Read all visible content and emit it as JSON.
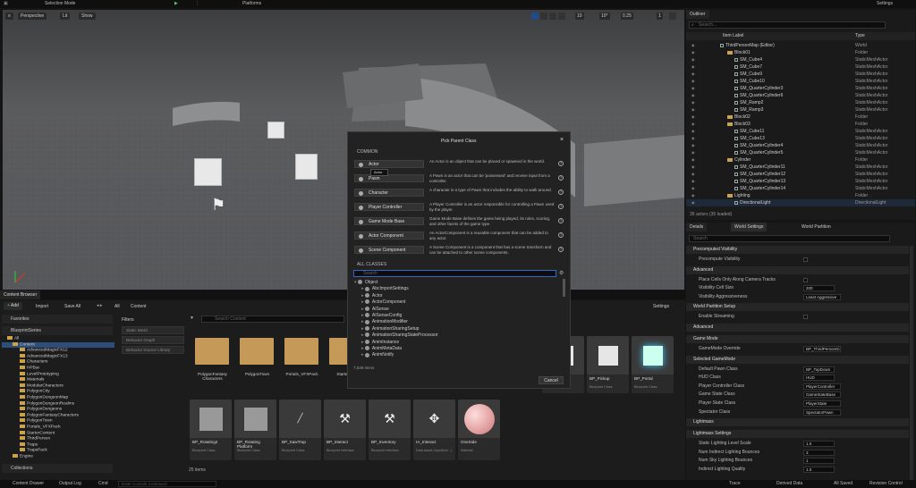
{
  "topbar": {
    "mode": "Selection Mode",
    "platforms": "Platforms",
    "settings": "Settings"
  },
  "viewport": {
    "perspective": "Perspective",
    "lit": "Lit",
    "show": "Show",
    "snap_angle": "10°",
    "snap_scale": "0.25",
    "cam_speed": "1",
    "grid": "10"
  },
  "outliner": {
    "tab": "Outliner",
    "col_label": "Item Label",
    "col_type": "Type",
    "search_placeholder": "Search...",
    "rows": [
      {
        "label": "ThirdPersonMap (Editor)",
        "type": "World",
        "indent": 0,
        "kind": "world"
      },
      {
        "label": "Block01",
        "type": "Folder",
        "indent": 1,
        "kind": "folder"
      },
      {
        "label": "SM_Cube4",
        "type": "StaticMeshActor",
        "indent": 2,
        "kind": "entity"
      },
      {
        "label": "SM_Cube7",
        "type": "StaticMeshActor",
        "indent": 2,
        "kind": "entity"
      },
      {
        "label": "SM_Cube9",
        "type": "StaticMeshActor",
        "indent": 2,
        "kind": "entity"
      },
      {
        "label": "SM_Cube10",
        "type": "StaticMeshActor",
        "indent": 2,
        "kind": "entity"
      },
      {
        "label": "SM_QuarterCylinder3",
        "type": "StaticMeshActor",
        "indent": 2,
        "kind": "entity"
      },
      {
        "label": "SM_QuarterCylinder6",
        "type": "StaticMeshActor",
        "indent": 2,
        "kind": "entity"
      },
      {
        "label": "SM_Ramp2",
        "type": "StaticMeshActor",
        "indent": 2,
        "kind": "entity"
      },
      {
        "label": "SM_Ramp3",
        "type": "StaticMeshActor",
        "indent": 2,
        "kind": "entity"
      },
      {
        "label": "Block02",
        "type": "Folder",
        "indent": 1,
        "kind": "folder"
      },
      {
        "label": "Block03",
        "type": "Folder",
        "indent": 1,
        "kind": "folder"
      },
      {
        "label": "SM_Cube11",
        "type": "StaticMeshActor",
        "indent": 2,
        "kind": "entity"
      },
      {
        "label": "SM_Cube13",
        "type": "StaticMeshActor",
        "indent": 2,
        "kind": "entity"
      },
      {
        "label": "SM_QuarterCylinder4",
        "type": "StaticMeshActor",
        "indent": 2,
        "kind": "entity"
      },
      {
        "label": "SM_QuarterCylinder5",
        "type": "StaticMeshActor",
        "indent": 2,
        "kind": "entity"
      },
      {
        "label": "Cylinder",
        "type": "Folder",
        "indent": 1,
        "kind": "folder"
      },
      {
        "label": "SM_QuarterCylinder11",
        "type": "StaticMeshActor",
        "indent": 2,
        "kind": "entity"
      },
      {
        "label": "SM_QuarterCylinder12",
        "type": "StaticMeshActor",
        "indent": 2,
        "kind": "entity"
      },
      {
        "label": "SM_QuarterCylinder13",
        "type": "StaticMeshActor",
        "indent": 2,
        "kind": "entity"
      },
      {
        "label": "SM_QuarterCylinder14",
        "type": "StaticMeshActor",
        "indent": 2,
        "kind": "entity"
      },
      {
        "label": "Lighting",
        "type": "Folder",
        "indent": 1,
        "kind": "folder"
      },
      {
        "label": "DirectionalLight",
        "type": "DirectionalLight",
        "indent": 2,
        "kind": "entity"
      }
    ],
    "status": "35 actors (35 loaded)"
  },
  "details": {
    "tabs": [
      "Details",
      "World Settings",
      "World Partition"
    ],
    "search_placeholder": "Search",
    "sections": [
      {
        "title": "Precomputed Visibility",
        "props": [
          {
            "label": "Precompute Visibility",
            "kind": "check"
          }
        ]
      },
      {
        "title": "Advanced",
        "props": [
          {
            "label": "Place Cells Only Along Camera Tracks",
            "kind": "check"
          },
          {
            "label": "Visibility Cell Size",
            "kind": "value",
            "value": "200"
          },
          {
            "label": "Visibility Aggressiveness",
            "kind": "value",
            "value": "Least Aggressive"
          }
        ]
      },
      {
        "title": "World Partition Setup",
        "props": [
          {
            "label": "Enable Streaming",
            "kind": "check"
          }
        ]
      },
      {
        "title": "Advanced",
        "props": []
      },
      {
        "title": "Game Mode",
        "props": [
          {
            "label": "GameMode Override",
            "kind": "value",
            "value": "BP_ThirdPersonGi"
          }
        ]
      },
      {
        "title": "Selected GameMode",
        "props": [
          {
            "label": "Default Pawn Class",
            "kind": "value",
            "value": "BP_TopDown"
          },
          {
            "label": "HUD Class",
            "kind": "value",
            "value": "HUD"
          },
          {
            "label": "Player Controller Class",
            "kind": "value",
            "value": "PlayerController"
          },
          {
            "label": "Game State Class",
            "kind": "value",
            "value": "GameStateBase"
          },
          {
            "label": "Player State Class",
            "kind": "value",
            "value": "PlayerState"
          },
          {
            "label": "Spectator Class",
            "kind": "value",
            "value": "SpectatorPawn"
          }
        ]
      },
      {
        "title": "Lightmass",
        "props": []
      },
      {
        "title": "Lightmass Settings",
        "props": [
          {
            "label": "Static Lighting Level Scale",
            "kind": "value",
            "value": "1.0"
          },
          {
            "label": "Num Indirect Lighting Bounces",
            "kind": "value",
            "value": "3"
          },
          {
            "label": "Num Sky Lighting Bounces",
            "kind": "value",
            "value": "1"
          },
          {
            "label": "Indirect Lighting Quality",
            "kind": "value",
            "value": "1.0"
          }
        ]
      }
    ]
  },
  "dialog": {
    "title": "Pick Parent Class",
    "common_header": "COMMON",
    "tooltip": "Actor",
    "common": [
      {
        "name": "Actor",
        "desc": "An Actor is an object that can be placed or spawned in the world."
      },
      {
        "name": "Pawn",
        "desc": "A Pawn is an actor that can be 'possessed' and receive input from a controller."
      },
      {
        "name": "Character",
        "desc": "A character is a type of Pawn that includes the ability to walk around."
      },
      {
        "name": "Player Controller",
        "desc": "A Player Controller is an actor responsible for controlling a Pawn used by the player."
      },
      {
        "name": "Game Mode Base",
        "desc": "Game Mode Base defines the game being played, its rules, scoring, and other facets of the game type."
      },
      {
        "name": "Actor Component",
        "desc": "An ActorComponent is a reusable component that can be added to any actor."
      },
      {
        "name": "Scene Component",
        "desc": "A Scene Component is a component that has a scene transform and can be attached to other scene components."
      }
    ],
    "all_header": "ALL CLASSES",
    "search_placeholder": "Search",
    "classes": [
      "Object",
      "AbcImportSettings",
      "Actor",
      "ActorComponent",
      "AISense",
      "AISenseConfig",
      "AnimationModifier",
      "AnimationSharingSetup",
      "AnimationSharingStateProcessor",
      "AnimInstance",
      "AnimMetaData",
      "AnimNotify"
    ],
    "count": "7,038 items",
    "cancel": "Cancel"
  },
  "content_browser": {
    "tab": "Content Browser",
    "add": "Add",
    "import": "Import",
    "save_all": "Save All",
    "path": [
      "All",
      "Content"
    ],
    "settings": "Settings",
    "favorites": "Favorites",
    "project": "BlueprintSeries",
    "tree": [
      "All",
      "Content",
      "AdvancedMagicFX12",
      "AdvancedMagicFX13",
      "Characters",
      "HPBar",
      "LevelPrototyping",
      "Materials",
      "ModularCharacters",
      "PolygonCity",
      "PolygonDungeonMap",
      "PolygonDungeonRealms",
      "PolygonDungeons",
      "PolygonFantasyCharacters",
      "PolygonTown",
      "Portals_VFXPack",
      "StarterContent",
      "ThirdPerson",
      "Traps",
      "TrapsPack",
      "Engine"
    ],
    "collections": "Collections",
    "filters_label": "Filters",
    "filters": [
      "Static Mesh",
      "Behavior Graph",
      "Behavior Source Library"
    ],
    "search_placeholder": "Search Content",
    "folders": [
      "PolygonFantasy Characters",
      "PolygonTown",
      "Portals_VFXPack",
      "StarterCon"
    ],
    "assets_row1": [
      {
        "name": "BP_Pickup",
        "cls": "Blueprint Class"
      },
      {
        "name": "BP_Portal",
        "cls": "Blueprint Class"
      }
    ],
    "assets_row2": [
      {
        "name": "BP_Rotating2",
        "cls": "Blueprint Class",
        "icon": "cube"
      },
      {
        "name": "BP_Rotating Platform",
        "cls": "Blueprint Class",
        "icon": "cube"
      },
      {
        "name": "BP_SawTrap",
        "cls": "Blueprint Class",
        "icon": "saw"
      },
      {
        "name": "BP_Interact",
        "cls": "Blueprint Interface",
        "icon": "interface"
      },
      {
        "name": "BP_Inventory",
        "cls": "Blueprint Interface",
        "icon": "interface"
      },
      {
        "name": "IA_Interact",
        "cls": "Data Asset (InputActi...)",
        "icon": "gamepad"
      },
      {
        "name": "OneSide",
        "cls": "Material",
        "icon": "sphere"
      }
    ],
    "item_count": "25 items"
  },
  "bottombar": {
    "content_drawer": "Content Drawer",
    "output_log": "Output Log",
    "cmd": "Cmd",
    "cmd_placeholder": "Enter Console Command",
    "trace": "Trace",
    "derived_data": "Derived Data",
    "all_saved": "All Saved",
    "revision_control": "Revision Control"
  }
}
